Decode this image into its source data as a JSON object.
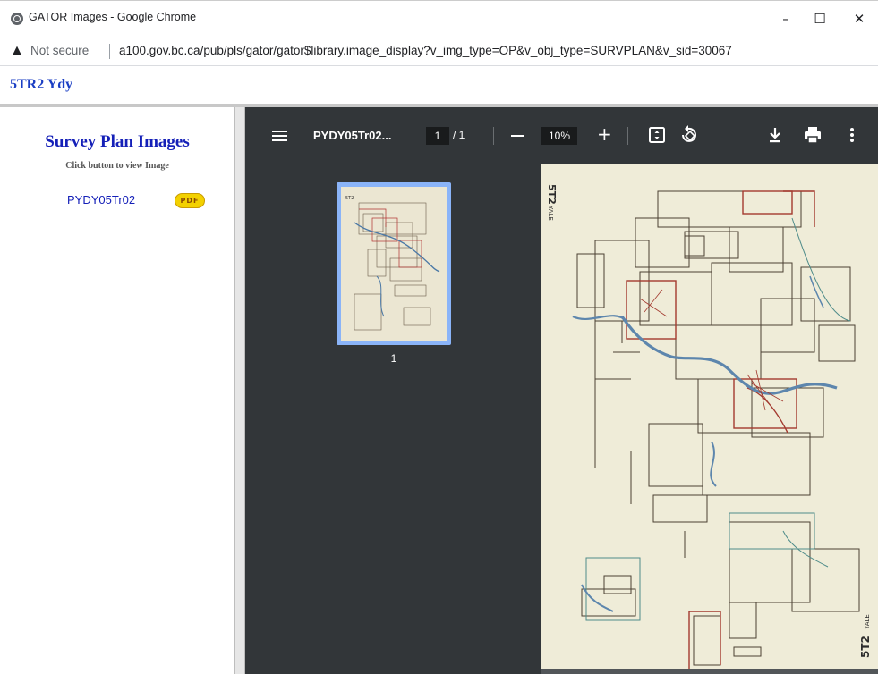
{
  "window": {
    "title": "GATOR Images - Google Chrome",
    "controls": {
      "minimize": "–",
      "maximize": "☐",
      "close": "✕"
    }
  },
  "addressbar": {
    "security": "Not secure",
    "url": "a100.gov.bc.ca/pub/pls/gator/gator$library.image_display?v_img_type=OP&v_obj_type=SURVPLAN&v_sid=30067"
  },
  "page_header": {
    "title": "5TR2 Ydy"
  },
  "left_panel": {
    "title": "Survey Plan Images",
    "subtitle": "Click button to view Image",
    "link": "PYDY05Tr02",
    "badge": "PDF"
  },
  "viewer": {
    "filename": "PYDY05Tr02...",
    "page_current": "1",
    "page_total": "/ 1",
    "zoom": "10%",
    "thumb_label": "1"
  },
  "map_text": {
    "corner_top": "5T2",
    "corner_top_sub": "YALE",
    "corner_bottom": "5T2",
    "corner_bottom_sub": "YALE"
  },
  "colors": {
    "chrome_dark": "#323639",
    "viewer_bg": "#525659",
    "link_blue": "#1520b8",
    "paper": "#efecd8"
  }
}
